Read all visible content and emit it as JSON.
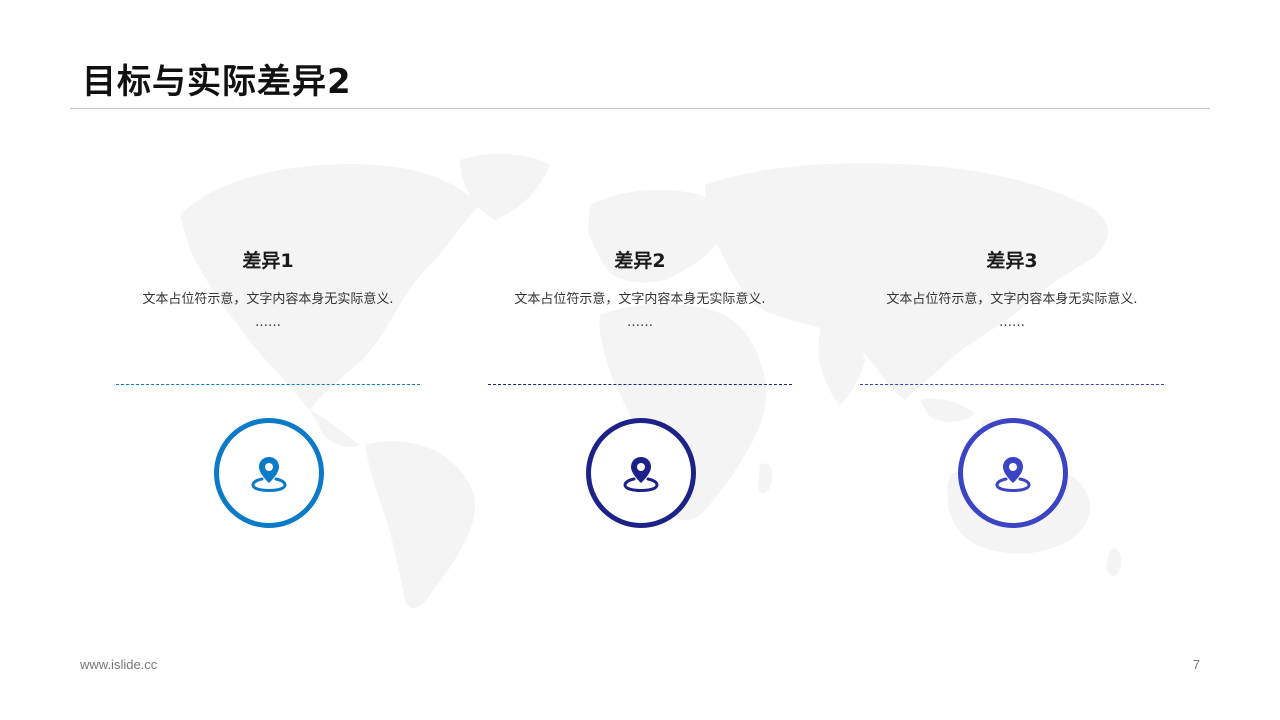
{
  "slide": {
    "title": "目标与实际差异2",
    "footer_url": "www.islide.cc",
    "page_number": "7"
  },
  "items": [
    {
      "title": "差异1",
      "description": "文本占位符示意，文字内容本身无实际意义.",
      "ellipsis": "……",
      "color": "#0a7ac9",
      "icon": "location-pin-icon"
    },
    {
      "title": "差异2",
      "description": "文本占位符示意，文字内容本身无实际意义.",
      "ellipsis": "……",
      "color": "#1c2288",
      "icon": "location-pin-icon"
    },
    {
      "title": "差异3",
      "description": "文本占位符示意，文字内容本身无实际意义.",
      "ellipsis": "……",
      "color": "#3a44c4",
      "icon": "location-pin-icon"
    }
  ],
  "background": {
    "map_color": "#f4f4f4"
  }
}
